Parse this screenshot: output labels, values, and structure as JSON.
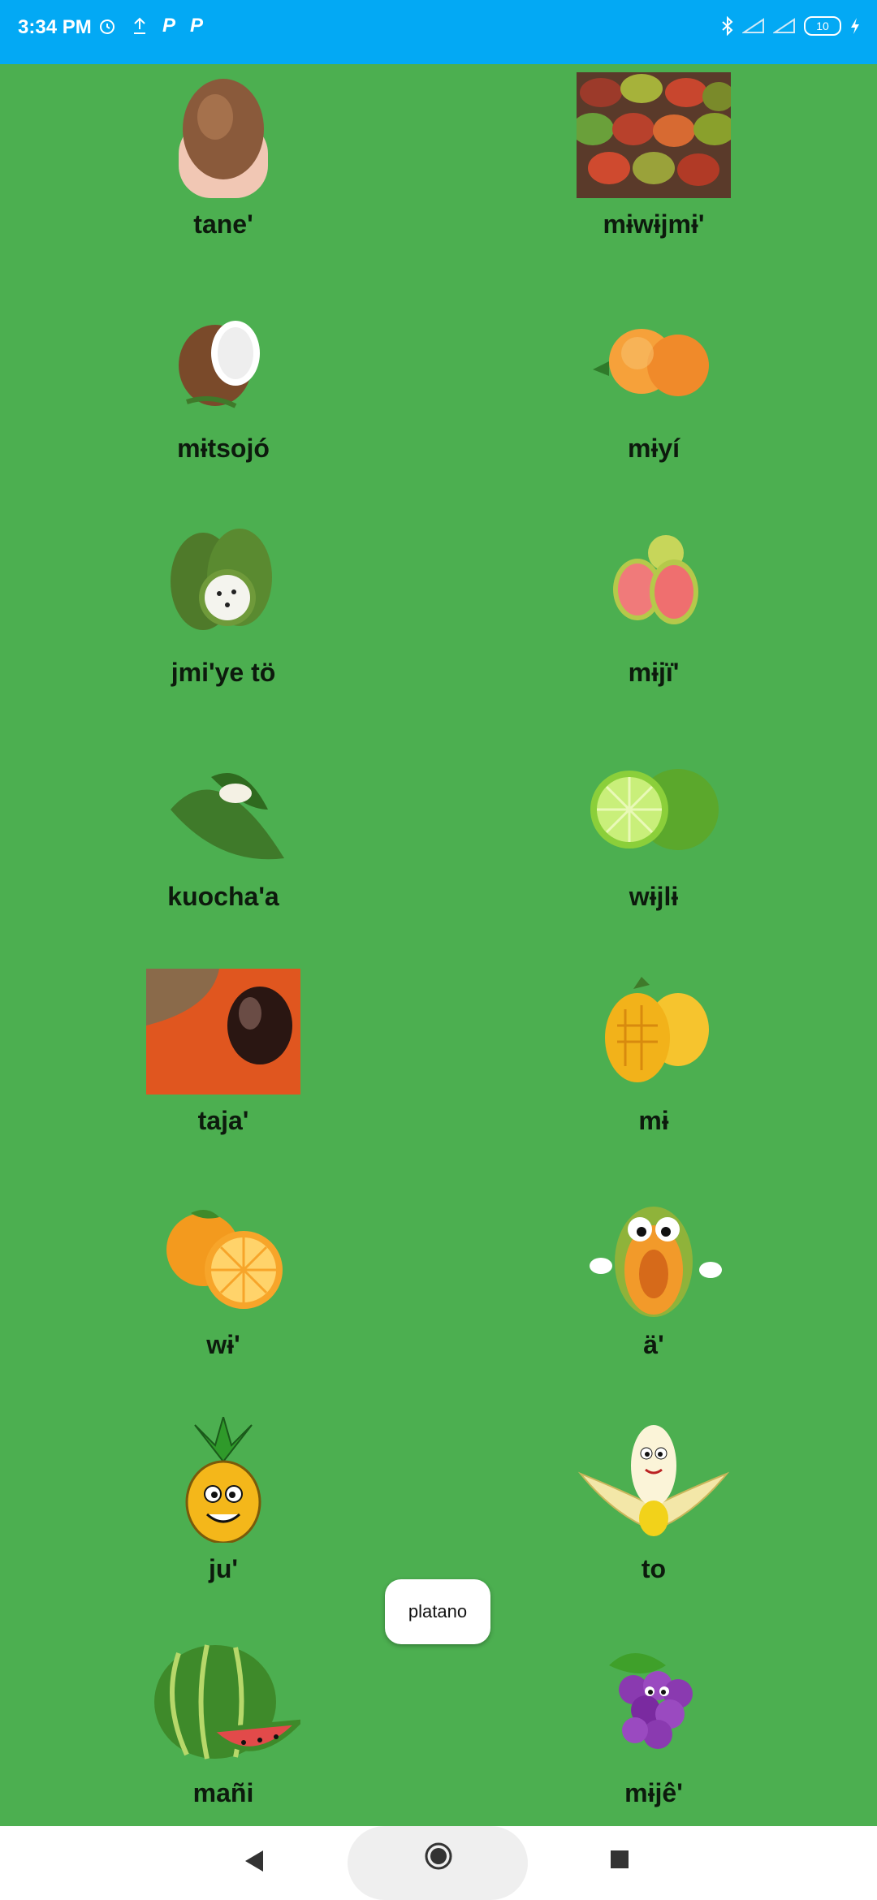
{
  "status": {
    "time": "3:34 PM",
    "battery": "10"
  },
  "fruits": [
    {
      "name": "tane'",
      "icon": "sapote-fruit-in-hand"
    },
    {
      "name": "mɨwɨjmɨ'",
      "icon": "mango-pile"
    },
    {
      "name": "mɨtsojó",
      "icon": "coconut"
    },
    {
      "name": "mɨyí",
      "icon": "peach"
    },
    {
      "name": "jmi'ye tö",
      "icon": "soursop"
    },
    {
      "name": "mɨjï'",
      "icon": "guava"
    },
    {
      "name": "kuocha'a",
      "icon": "pod"
    },
    {
      "name": "wɨjlɨ",
      "icon": "lime"
    },
    {
      "name": "taja'",
      "icon": "mamey-sapote"
    },
    {
      "name": "mɨ",
      "icon": "mango"
    },
    {
      "name": "wɨ'",
      "icon": "orange"
    },
    {
      "name": "ä'",
      "icon": "papaya-cartoon"
    },
    {
      "name": "ju'",
      "icon": "pineapple-cartoon"
    },
    {
      "name": "to",
      "icon": "banana-cartoon"
    },
    {
      "name": "mañi",
      "icon": "watermelon"
    },
    {
      "name": "mɨjê'",
      "icon": "grapes-cartoon"
    }
  ],
  "toast": {
    "text": "platano"
  }
}
